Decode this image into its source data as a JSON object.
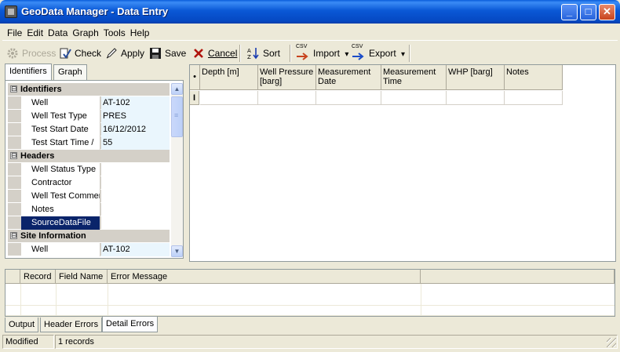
{
  "window": {
    "title": "GeoData Manager - Data Entry",
    "controls": {
      "minimize": "_",
      "maximize": "□",
      "close": "✕"
    }
  },
  "menu": [
    "File",
    "Edit",
    "Data",
    "Graph",
    "Tools",
    "Help"
  ],
  "toolbar": {
    "process": "Process",
    "check": "Check",
    "apply": "Apply",
    "save": "Save",
    "cancel": "Cancel",
    "sort": "Sort",
    "import": "Import",
    "export": "Export",
    "csv_badge": "CSV",
    "dropdown_arrow": "▾"
  },
  "left_tabs": [
    "Identifiers",
    "Graph"
  ],
  "property_grid": {
    "expander_symbol": "⊟",
    "categories": [
      {
        "name": "Identifiers",
        "rows": [
          {
            "name": "Well",
            "value": "AT-102"
          },
          {
            "name": "Well Test Type",
            "value": "PRES"
          },
          {
            "name": "Test Start Date",
            "value": "16/12/2012"
          },
          {
            "name": "Test Start Time /",
            "value": "55"
          }
        ]
      },
      {
        "name": "Headers",
        "rows": [
          {
            "name": "Well Status Type",
            "value": ""
          },
          {
            "name": "Contractor",
            "value": ""
          },
          {
            "name": "Well Test Commer",
            "value": ""
          },
          {
            "name": "Notes",
            "value": ""
          },
          {
            "name": "SourceDataFile",
            "value": ""
          }
        ]
      },
      {
        "name": "Site Information",
        "rows": [
          {
            "name": "Well",
            "value": "AT-102"
          }
        ]
      }
    ],
    "selected_row": "SourceDataFile"
  },
  "data_grid": {
    "corner_marker": "•",
    "row_marker": "I",
    "columns": [
      "Depth [m]",
      "Well Pressure [barg]",
      "Measurement Date",
      "Measurement Time",
      "WHP [barg]",
      "Notes"
    ]
  },
  "errors_grid": {
    "columns": [
      "Record",
      "Field Name",
      "Error Message",
      ""
    ]
  },
  "bottom_tabs": [
    "Output",
    "Header Errors",
    "Detail Errors"
  ],
  "active_bottom_tab": "Detail Errors",
  "status": {
    "state": "Modified",
    "records": "1 records"
  }
}
